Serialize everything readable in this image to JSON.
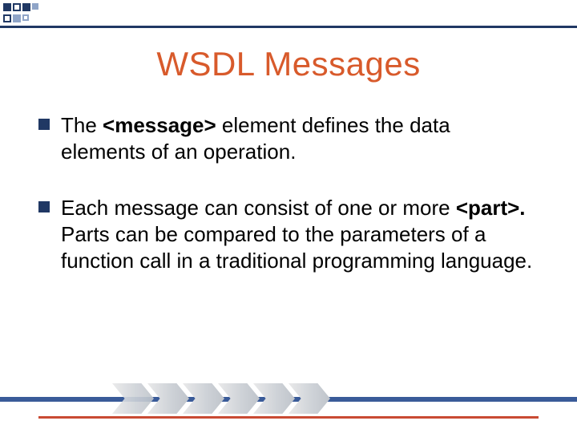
{
  "title": "WSDL Messages",
  "bullets": [
    {
      "pre": "The ",
      "bold": "<message>",
      "post": " element defines the data elements of an operation."
    },
    {
      "pre": "Each message can consist of one or more ",
      "bold": "<part>.",
      "post": " Parts can be compared to the parameters of a function call in a traditional programming language."
    }
  ]
}
